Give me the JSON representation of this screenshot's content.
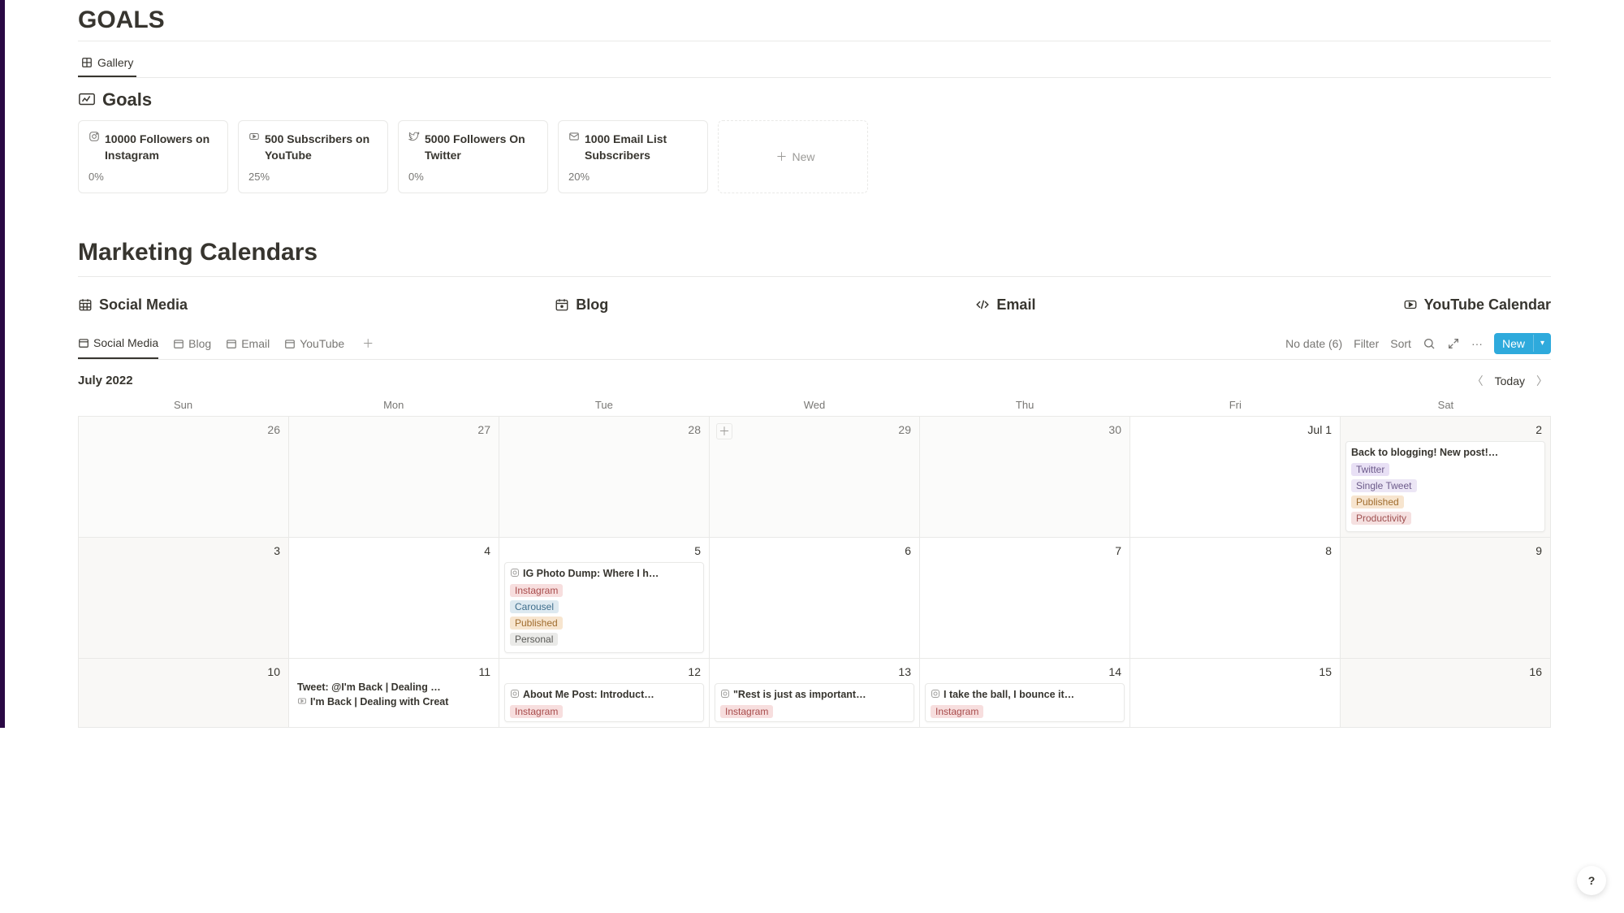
{
  "goals_section_title": "GOALS",
  "gallery_tab": "Gallery",
  "goals_subheading": "Goals",
  "goals": [
    {
      "title": "10000 Followers on Instagram",
      "pct": "0%"
    },
    {
      "title": "500 Subscribers on YouTube",
      "pct": "25%"
    },
    {
      "title": "5000 Followers On Twitter",
      "pct": "0%"
    },
    {
      "title": "1000 Email List Subscribers",
      "pct": "20%"
    }
  ],
  "new_card_label": "New",
  "marketing_title": "Marketing Calendars",
  "links": {
    "social": "Social Media",
    "blog": "Blog",
    "email": "Email",
    "youtube": "YouTube Calendar"
  },
  "db_tabs": {
    "social": "Social Media",
    "blog": "Blog",
    "email": "Email",
    "youtube": "YouTube"
  },
  "controls": {
    "nodate": "No date (6)",
    "filter": "Filter",
    "sort": "Sort",
    "new": "New"
  },
  "calendar": {
    "month": "July 2022",
    "today": "Today",
    "days": [
      "Sun",
      "Mon",
      "Tue",
      "Wed",
      "Thu",
      "Fri",
      "Sat"
    ]
  },
  "week1": [
    "26",
    "27",
    "28",
    "29",
    "30",
    "Jul 1",
    "2"
  ],
  "week2": [
    "3",
    "4",
    "5",
    "6",
    "7",
    "8",
    "9"
  ],
  "week3": [
    "10",
    "11",
    "12",
    "13",
    "14",
    "15",
    "16"
  ],
  "events": {
    "jul2": {
      "title": "Back to blogging! New post!…",
      "tags": [
        "Twitter",
        "Single Tweet",
        "Published",
        "Productivity"
      ]
    },
    "jul5": {
      "title": "IG Photo Dump: Where I h…",
      "tags": [
        "Instagram",
        "Carousel",
        "Published",
        "Personal"
      ]
    },
    "jul11a": "Tweet: @I'm Back | Dealing …",
    "jul11b": "I'm Back | Dealing with Creat",
    "jul12": {
      "title": "About Me Post: Introduct…",
      "tag": "Instagram"
    },
    "jul13": {
      "title": "\"Rest is just as important…",
      "tag": "Instagram"
    },
    "jul14": {
      "title": "I take the ball, I bounce it…",
      "tag": "Instagram"
    }
  }
}
